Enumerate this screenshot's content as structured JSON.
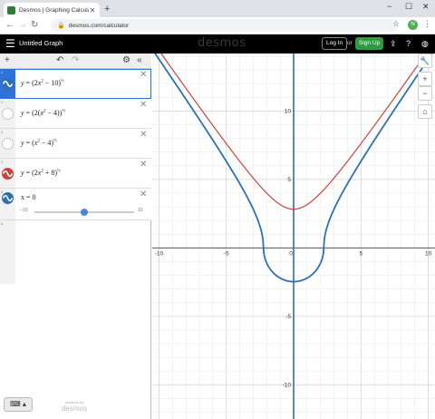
{
  "browser": {
    "tab_title": "Desmos | Graphing Calculator",
    "url": "desmos.com/calculator",
    "avatar_letter": "N"
  },
  "header": {
    "graph_title": "Untitled Graph",
    "brand": "desmos",
    "login_label": "Log In",
    "or_label": "or",
    "signup_label": "Sign Up"
  },
  "expressions": [
    {
      "index": "1",
      "color": "#2d70b3",
      "visible": true
    },
    {
      "index": "2",
      "color": "#c8c8c8",
      "visible": false
    },
    {
      "index": "3",
      "color": "#c8c8c8",
      "visible": false
    },
    {
      "index": "4",
      "color": "#c74440",
      "visible": true
    },
    {
      "index": "5",
      "color": "#2d70b3",
      "visible": true,
      "text": "x = 0",
      "slider_min": "−10",
      "slider_max": "10",
      "slider_fraction": 0.5
    }
  ],
  "empty_row_index": "6",
  "footer": {
    "powered_by": "powered by",
    "powered_brand": "desmos"
  },
  "chart_data": {
    "type": "line",
    "xlim": [
      -10.5,
      10.5
    ],
    "ylim": [
      -12.5,
      14.2
    ],
    "grid": true,
    "x_ticks": [
      -10,
      -5,
      0,
      5,
      10
    ],
    "y_ticks": [
      10,
      5,
      -5,
      -10
    ],
    "x_tick_labels": [
      "-10",
      "-5",
      "0",
      "5",
      "10"
    ],
    "y_tick_labels": [
      "10",
      "5",
      "-5",
      "-10"
    ],
    "series": [
      {
        "expr": "y = (2x^2 - 10)^(1/2)",
        "color": "#2d70b3",
        "kind": "blue_curve"
      },
      {
        "expr": "y = (2x^2 + 8)^(1/2)",
        "color": "#c74440",
        "kind": "red_curve"
      },
      {
        "expr": "x = 0",
        "color": "#2d70b3",
        "kind": "vertical_line",
        "x": 0
      }
    ]
  }
}
